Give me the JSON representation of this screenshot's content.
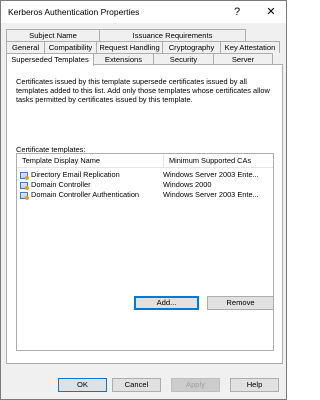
{
  "window": {
    "title": "Kerberos Authentication Properties",
    "help_glyph": "?",
    "close_glyph": "✕"
  },
  "tabs_row1": [
    "Subject Name",
    "Issuance Requirements"
  ],
  "tabs_row2": [
    "General",
    "Compatibility",
    "Request Handling",
    "Cryptography",
    "Key Attestation"
  ],
  "tabs_row3": [
    "Superseded Templates",
    "Extensions",
    "Security",
    "Server"
  ],
  "selected_tab": "Superseded Templates",
  "description": "Certificates issued by this template supersede certificates issued by all templates added to this list. Add only those templates whose certificates allow tasks permitted by certificates issued by this template.",
  "list": {
    "label": "Certificate templates:",
    "columns": [
      "Template Display Name",
      "Minimum Supported CAs"
    ],
    "rows": [
      {
        "name": "Directory Email Replication",
        "ca": "Windows Server 2003 Ente..."
      },
      {
        "name": "Domain Controller",
        "ca": "Windows 2000"
      },
      {
        "name": "Domain Controller Authentication",
        "ca": "Windows Server 2003 Ente..."
      }
    ],
    "row_icon": "certificate-template-icon"
  },
  "buttons": {
    "add": "Add...",
    "remove": "Remove",
    "ok": "OK",
    "cancel": "Cancel",
    "apply": "Apply",
    "help": "Help"
  },
  "colors": {
    "accent": "#0078d7",
    "dialog_bg": "#f0f0f0"
  }
}
